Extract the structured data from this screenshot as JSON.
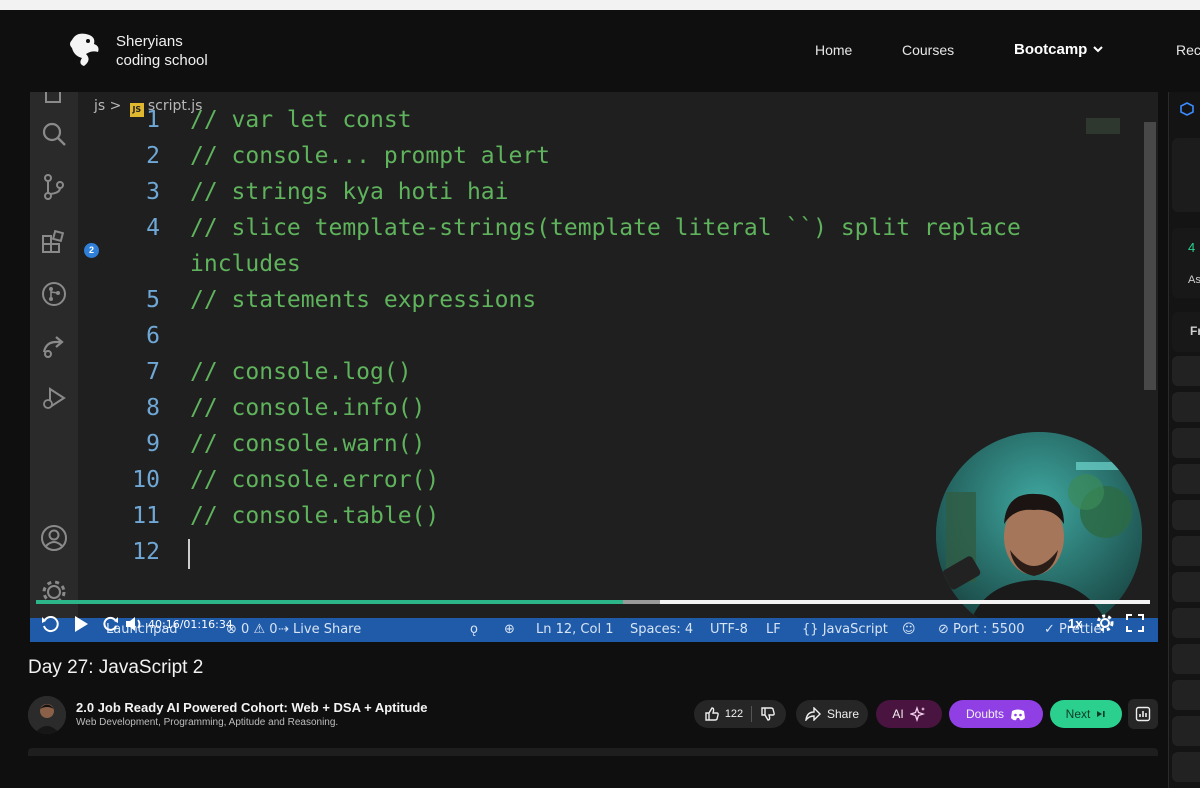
{
  "header": {
    "brand_line1": "Sheryians",
    "brand_line2": "coding school",
    "nav": [
      "Home",
      "Courses",
      "Bootcamp",
      "Rec"
    ]
  },
  "editor": {
    "breadcrumb_folder": "js",
    "breadcrumb_file": "script.js",
    "extensions_badge": "2",
    "lines": [
      {
        "n": "1",
        "text": "// var let const"
      },
      {
        "n": "2",
        "text": "// console... prompt alert"
      },
      {
        "n": "3",
        "text": "// strings kya hoti hai"
      },
      {
        "n": "4",
        "text": "// slice template-strings(template literal ``) split replace"
      },
      {
        "n": "",
        "text": "includes"
      },
      {
        "n": "5",
        "text": "// statements expressions"
      },
      {
        "n": "6",
        "text": ""
      },
      {
        "n": "7",
        "text": "// console.log()"
      },
      {
        "n": "8",
        "text": "// console.info()"
      },
      {
        "n": "9",
        "text": "// console.warn()"
      },
      {
        "n": "10",
        "text": "// console.error()"
      },
      {
        "n": "11",
        "text": "// console.table()"
      },
      {
        "n": "12",
        "text": ""
      }
    ],
    "status": {
      "launchpad": "Launchpad",
      "errors": "0",
      "warnings": "0",
      "live_share": "Live Share",
      "position": "Ln 12, Col 1",
      "spaces": "Spaces: 4",
      "encoding": "UTF-8",
      "eol": "LF",
      "language": "JavaScript",
      "port": "Port : 5500",
      "prettier": "Prettier"
    }
  },
  "player": {
    "time": "40:16/01:16:34",
    "speed": "1x",
    "progress_fraction": 0.527,
    "buffered_fraction": 0.56
  },
  "lesson": {
    "title": "Day 27: JavaScript 2",
    "course_title": "2.0 Job Ready AI Powered Cohort: Web + DSA + Aptitude",
    "course_subtitle": "Web Development, Programming, Aptitude and Reasoning."
  },
  "actions": {
    "likes": "122",
    "share": "Share",
    "ai": "AI",
    "doubts": "Doubts",
    "next": "Next"
  },
  "right_panel": {
    "fragments": [
      "4",
      "As",
      "Fr"
    ]
  },
  "colors": {
    "accent_green": "#2bd08f",
    "doubts_purple": "#8f3fe4",
    "ai_maroon": "#4a1440",
    "statusbar_blue": "#1f5ba8",
    "code_comment": "#5fb35c",
    "line_number": "#6fa8d6"
  },
  "icons": [
    "logo-icon",
    "chevron-down-icon",
    "explorer-icon",
    "search-icon",
    "source-control-icon",
    "extensions-icon",
    "git-graph-icon",
    "remote-icon",
    "run-debug-icon",
    "account-icon",
    "settings-icon",
    "replay-icon",
    "play-icon",
    "forward-icon",
    "volume-icon",
    "gear-icon",
    "fullscreen-icon",
    "thumbs-up-icon",
    "thumbs-down-icon",
    "share-icon",
    "sparkle-icon",
    "discord-icon",
    "skip-next-icon",
    "stats-icon"
  ]
}
